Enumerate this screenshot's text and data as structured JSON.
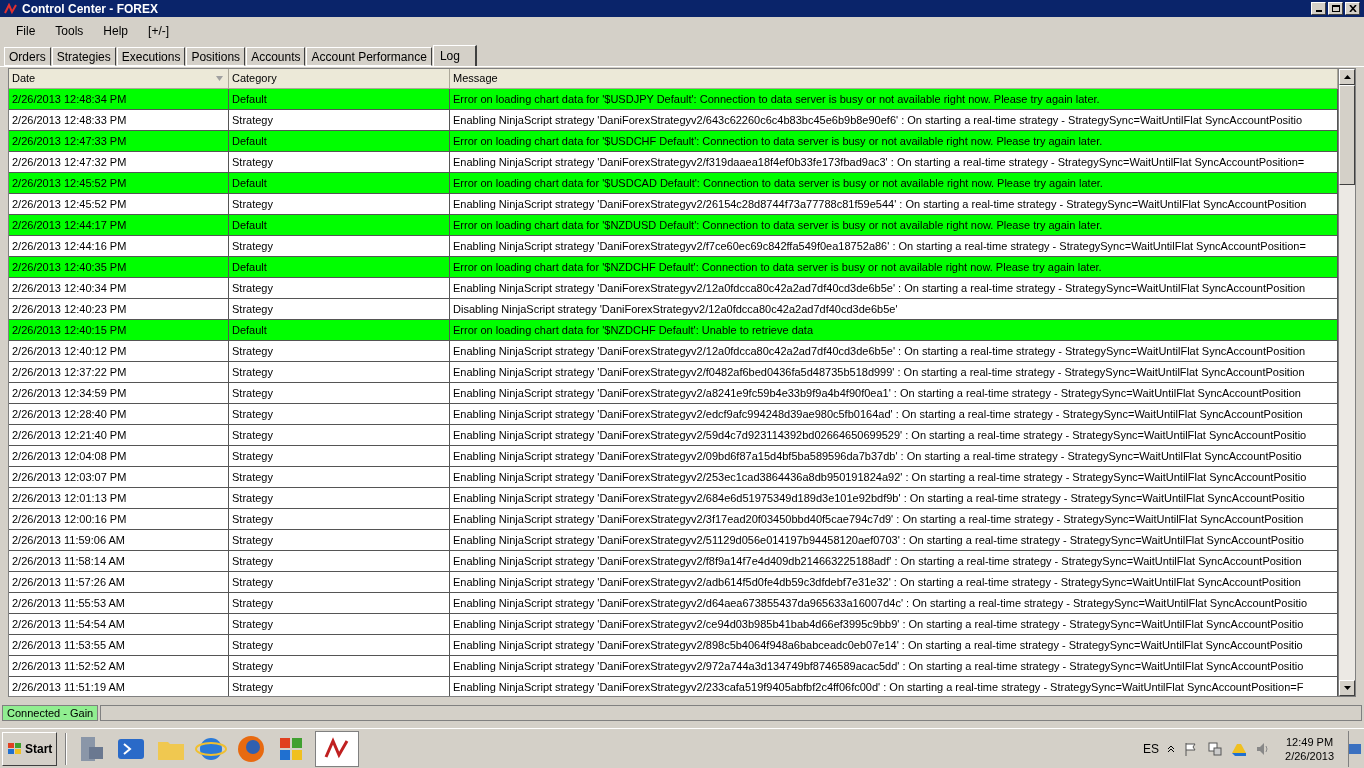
{
  "window": {
    "title": "Control Center - FOREX"
  },
  "menu": [
    "File",
    "Tools",
    "Help",
    "[+/-]"
  ],
  "tabs": [
    {
      "label": "Orders",
      "selected": false
    },
    {
      "label": "Strategies",
      "selected": false
    },
    {
      "label": "Executions",
      "selected": false
    },
    {
      "label": "Positions",
      "selected": false
    },
    {
      "label": "Accounts",
      "selected": false
    },
    {
      "label": "Account Performance",
      "selected": false
    },
    {
      "label": "Log",
      "selected": true
    }
  ],
  "table": {
    "columns": [
      "Date",
      "Category",
      "Message"
    ],
    "rows": [
      {
        "date": "2/26/2013 12:48:34 PM",
        "category": "Default",
        "message": "Error on loading chart data for '$USDJPY Default': Connection to data server is busy or not available right now. Please try again later.",
        "highlighted": true
      },
      {
        "date": "2/26/2013 12:48:33 PM",
        "category": "Strategy",
        "message": "Enabling NinjaScript strategy 'DaniForexStrategyv2/643c62260c6c4b83bc45e6b9b8e90ef6' : On starting a real-time strategy - StrategySync=WaitUntilFlat SyncAccountPositio",
        "highlighted": false
      },
      {
        "date": "2/26/2013 12:47:33 PM",
        "category": "Default",
        "message": "Error on loading chart data for '$USDCHF Default': Connection to data server is busy or not available right now. Please try again later.",
        "highlighted": true
      },
      {
        "date": "2/26/2013 12:47:32 PM",
        "category": "Strategy",
        "message": "Enabling NinjaScript strategy 'DaniForexStrategyv2/f319daaea18f4ef0b33fe173fbad9ac3' : On starting a real-time strategy - StrategySync=WaitUntilFlat SyncAccountPosition=",
        "highlighted": false
      },
      {
        "date": "2/26/2013 12:45:52 PM",
        "category": "Default",
        "message": "Error on loading chart data for '$USDCAD Default': Connection to data server is busy or not available right now. Please try again later.",
        "highlighted": true
      },
      {
        "date": "2/26/2013 12:45:52 PM",
        "category": "Strategy",
        "message": "Enabling NinjaScript strategy 'DaniForexStrategyv2/26154c28d8744f73a77788c81f59e544' : On starting a real-time strategy - StrategySync=WaitUntilFlat SyncAccountPosition",
        "highlighted": false
      },
      {
        "date": "2/26/2013 12:44:17 PM",
        "category": "Default",
        "message": "Error on loading chart data for '$NZDUSD Default': Connection to data server is busy or not available right now. Please try again later.",
        "highlighted": true
      },
      {
        "date": "2/26/2013 12:44:16 PM",
        "category": "Strategy",
        "message": "Enabling NinjaScript strategy 'DaniForexStrategyv2/f7ce60ec69c842ffa549f0ea18752a86' : On starting a real-time strategy - StrategySync=WaitUntilFlat SyncAccountPosition=",
        "highlighted": false
      },
      {
        "date": "2/26/2013 12:40:35 PM",
        "category": "Default",
        "message": "Error on loading chart data for '$NZDCHF Default': Connection to data server is busy or not available right now. Please try again later.",
        "highlighted": true
      },
      {
        "date": "2/26/2013 12:40:34 PM",
        "category": "Strategy",
        "message": "Enabling NinjaScript strategy 'DaniForexStrategyv2/12a0fdcca80c42a2ad7df40cd3de6b5e' : On starting a real-time strategy - StrategySync=WaitUntilFlat SyncAccountPosition",
        "highlighted": false
      },
      {
        "date": "2/26/2013 12:40:23 PM",
        "category": "Strategy",
        "message": "Disabling NinjaScript strategy 'DaniForexStrategyv2/12a0fdcca80c42a2ad7df40cd3de6b5e'",
        "highlighted": false
      },
      {
        "date": "2/26/2013 12:40:15 PM",
        "category": "Default",
        "message": "Error on loading chart data for '$NZDCHF Default': Unable to retrieve data",
        "highlighted": true
      },
      {
        "date": "2/26/2013 12:40:12 PM",
        "category": "Strategy",
        "message": "Enabling NinjaScript strategy 'DaniForexStrategyv2/12a0fdcca80c42a2ad7df40cd3de6b5e' : On starting a real-time strategy - StrategySync=WaitUntilFlat SyncAccountPosition",
        "highlighted": false
      },
      {
        "date": "2/26/2013 12:37:22 PM",
        "category": "Strategy",
        "message": "Enabling NinjaScript strategy 'DaniForexStrategyv2/f0482af6bed0436fa5d48735b518d999' : On starting a real-time strategy - StrategySync=WaitUntilFlat SyncAccountPosition",
        "highlighted": false
      },
      {
        "date": "2/26/2013 12:34:59 PM",
        "category": "Strategy",
        "message": "Enabling NinjaScript strategy 'DaniForexStrategyv2/a8241e9fc59b4e33b9f9a4b4f90f0ea1' : On starting a real-time strategy - StrategySync=WaitUntilFlat SyncAccountPosition",
        "highlighted": false
      },
      {
        "date": "2/26/2013 12:28:40 PM",
        "category": "Strategy",
        "message": "Enabling NinjaScript strategy 'DaniForexStrategyv2/edcf9afc994248d39ae980c5fb0164ad' : On starting a real-time strategy - StrategySync=WaitUntilFlat SyncAccountPosition",
        "highlighted": false
      },
      {
        "date": "2/26/2013 12:21:40 PM",
        "category": "Strategy",
        "message": "Enabling NinjaScript strategy 'DaniForexStrategyv2/59d4c7d923114392bd02664650699529' : On starting a real-time strategy - StrategySync=WaitUntilFlat SyncAccountPositio",
        "highlighted": false
      },
      {
        "date": "2/26/2013 12:04:08 PM",
        "category": "Strategy",
        "message": "Enabling NinjaScript strategy 'DaniForexStrategyv2/09bd6f87a15d4bf5ba589596da7b37db' : On starting a real-time strategy - StrategySync=WaitUntilFlat SyncAccountPositio",
        "highlighted": false
      },
      {
        "date": "2/26/2013 12:03:07 PM",
        "category": "Strategy",
        "message": "Enabling NinjaScript strategy 'DaniForexStrategyv2/253ec1cad3864436a8db950191824a92' : On starting a real-time strategy - StrategySync=WaitUntilFlat SyncAccountPositio",
        "highlighted": false
      },
      {
        "date": "2/26/2013 12:01:13 PM",
        "category": "Strategy",
        "message": "Enabling NinjaScript strategy 'DaniForexStrategyv2/684e6d51975349d189d3e101e92bdf9b' : On starting a real-time strategy - StrategySync=WaitUntilFlat SyncAccountPositio",
        "highlighted": false
      },
      {
        "date": "2/26/2013 12:00:16 PM",
        "category": "Strategy",
        "message": "Enabling NinjaScript strategy 'DaniForexStrategyv2/3f17ead20f03450bbd40f5cae794c7d9' : On starting a real-time strategy - StrategySync=WaitUntilFlat SyncAccountPosition",
        "highlighted": false
      },
      {
        "date": "2/26/2013 11:59:06 AM",
        "category": "Strategy",
        "message": "Enabling NinjaScript strategy 'DaniForexStrategyv2/51129d056e014197b94458120aef0703' : On starting a real-time strategy - StrategySync=WaitUntilFlat SyncAccountPositio",
        "highlighted": false
      },
      {
        "date": "2/26/2013 11:58:14 AM",
        "category": "Strategy",
        "message": "Enabling NinjaScript strategy 'DaniForexStrategyv2/f8f9a14f7e4d409db214663225188adf' : On starting a real-time strategy - StrategySync=WaitUntilFlat SyncAccountPosition",
        "highlighted": false
      },
      {
        "date": "2/26/2013 11:57:26 AM",
        "category": "Strategy",
        "message": "Enabling NinjaScript strategy 'DaniForexStrategyv2/adb614f5d0fe4db59c3dfdebf7e31e32' : On starting a real-time strategy - StrategySync=WaitUntilFlat SyncAccountPosition",
        "highlighted": false
      },
      {
        "date": "2/26/2013 11:55:53 AM",
        "category": "Strategy",
        "message": "Enabling NinjaScript strategy 'DaniForexStrategyv2/d64aea673855437da965633a16007d4c' : On starting a real-time strategy - StrategySync=WaitUntilFlat SyncAccountPositio",
        "highlighted": false
      },
      {
        "date": "2/26/2013 11:54:54 AM",
        "category": "Strategy",
        "message": "Enabling NinjaScript strategy 'DaniForexStrategyv2/ce94d03b985b41bab4d66ef3995c9bb9' : On starting a real-time strategy - StrategySync=WaitUntilFlat SyncAccountPositio",
        "highlighted": false
      },
      {
        "date": "2/26/2013 11:53:55 AM",
        "category": "Strategy",
        "message": "Enabling NinjaScript strategy 'DaniForexStrategyv2/898c5b4064f948a6babceadc0eb07e14' : On starting a real-time strategy - StrategySync=WaitUntilFlat SyncAccountPositio",
        "highlighted": false
      },
      {
        "date": "2/26/2013 11:52:52 AM",
        "category": "Strategy",
        "message": "Enabling NinjaScript strategy 'DaniForexStrategyv2/972a744a3d134749bf8746589acac5dd' : On starting a real-time strategy - StrategySync=WaitUntilFlat SyncAccountPositio",
        "highlighted": false
      },
      {
        "date": "2/26/2013 11:51:19 AM",
        "category": "Strategy",
        "message": "Enabling NinjaScript strategy 'DaniForexStrategyv2/233cafa519f9405abfbf2c4ff06fc00d' : On starting a real-time strategy - StrategySync=WaitUntilFlat SyncAccountPosition=F",
        "highlighted": false
      }
    ]
  },
  "status_bar": {
    "text": "Connected - Gain"
  },
  "taskbar": {
    "start": "Start",
    "language": "ES",
    "time": "12:49 PM",
    "date": "2/26/2013"
  }
}
